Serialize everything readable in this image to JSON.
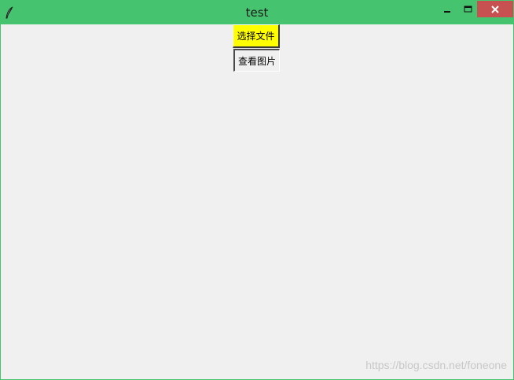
{
  "window": {
    "title": "test",
    "icon": "feather-icon",
    "controls": {
      "minimize": "minimize-icon",
      "maximize": "maximize-icon",
      "close": "close-icon",
      "close_color": "#c75050"
    },
    "titlebar_color": "#46c36f"
  },
  "buttons": {
    "select_file": {
      "label": "选择文件",
      "background": "#ffff00"
    },
    "view_image": {
      "label": "查看图片",
      "background": "#f0f0f0"
    }
  },
  "watermark": "https://blog.csdn.net/foneone"
}
